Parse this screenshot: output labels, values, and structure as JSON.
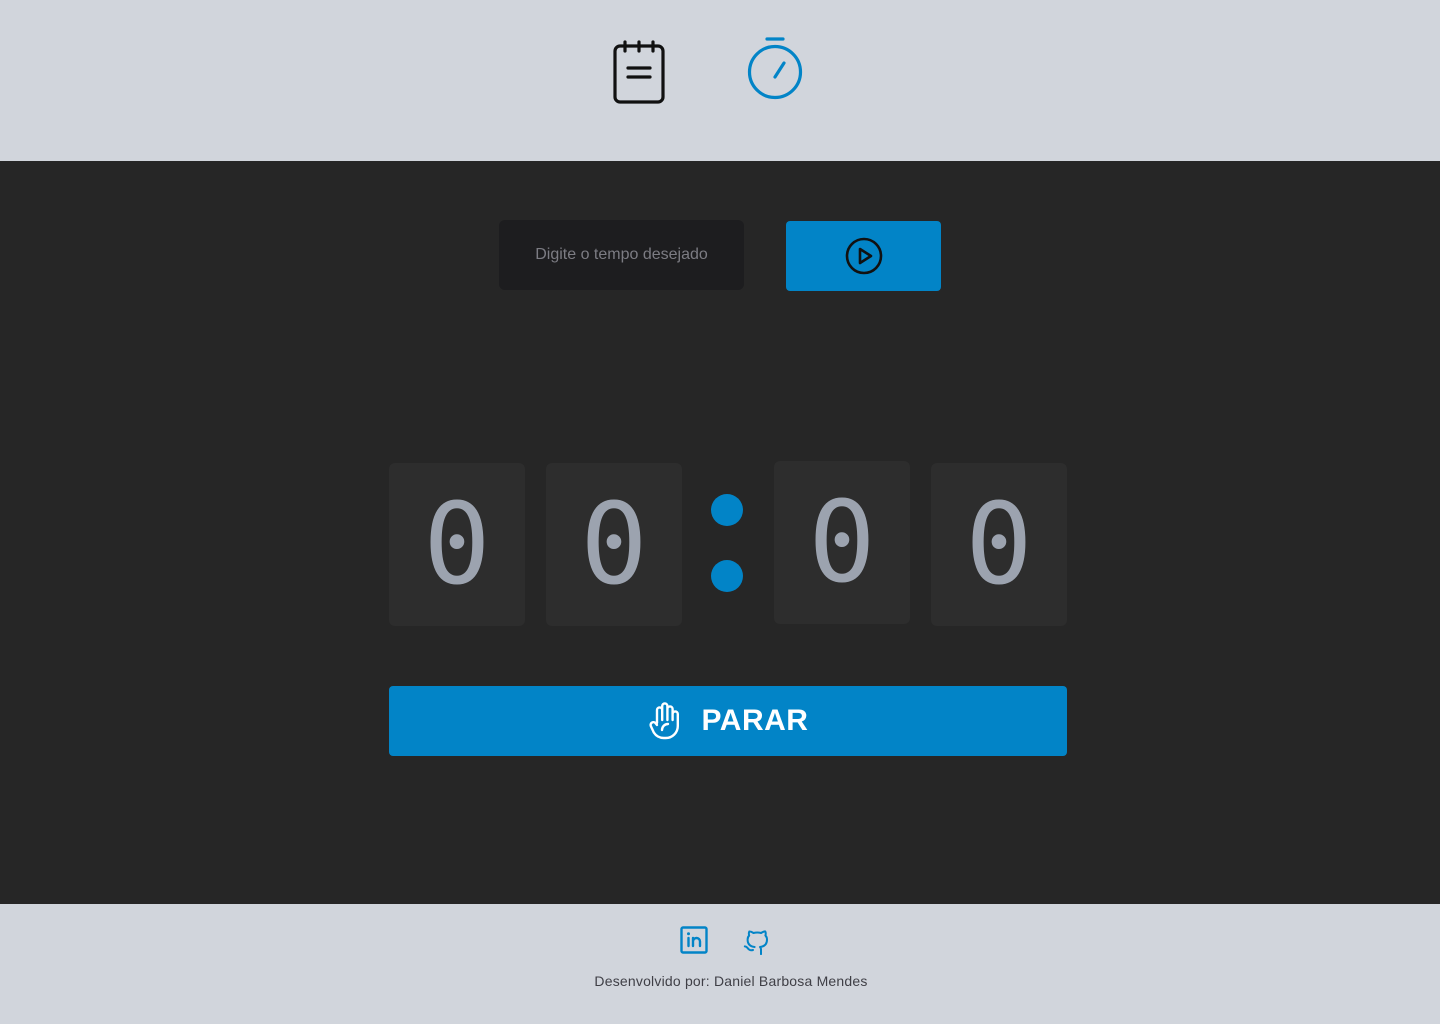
{
  "colors": {
    "accent": "#0284c7",
    "header_bg": "#d1d5dc",
    "main_bg": "#262626",
    "digit_bg": "#2d2d2d",
    "digit_text": "#9ca3af",
    "input_bg": "#1d1d1f",
    "nav_icon_inactive": "#111111"
  },
  "nav": {
    "items": [
      {
        "icon": "notepad-icon",
        "active": false
      },
      {
        "icon": "stopwatch-icon",
        "active": true
      }
    ]
  },
  "timer_form": {
    "input_placeholder": "Digite o tempo desejado",
    "input_value": "",
    "start_button_icon": "play-circle-icon"
  },
  "timer_display": {
    "digits": [
      "0",
      "0",
      "0",
      "0"
    ],
    "separator": ":"
  },
  "stop_button": {
    "label": "PARAR",
    "icon": "hand-icon"
  },
  "footer": {
    "links": [
      {
        "icon": "linkedin-icon"
      },
      {
        "icon": "github-icon"
      }
    ],
    "credit": "Desenvolvido por: Daniel Barbosa Mendes"
  }
}
